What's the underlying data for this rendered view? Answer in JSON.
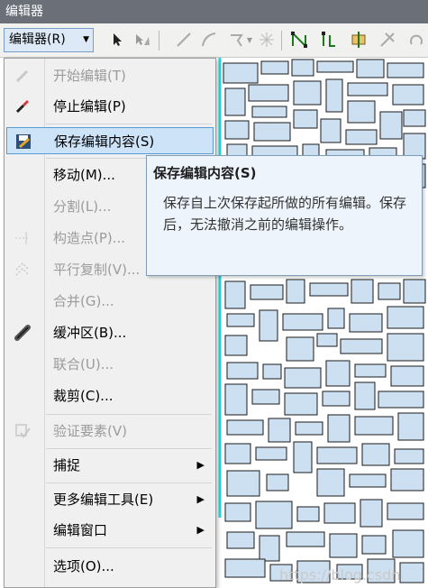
{
  "window": {
    "title": "编辑器"
  },
  "toolbar": {
    "editor_menu_label": "编辑器(R)"
  },
  "menu": {
    "items": [
      {
        "label": "开始编辑(T)",
        "disabled": true
      },
      {
        "label": "停止编辑(P)",
        "disabled": false
      },
      {
        "label": "保存编辑内容(S)",
        "disabled": false,
        "highlighted": true
      },
      {
        "label": "移动(M)...",
        "disabled": false
      },
      {
        "label": "分割(L)...",
        "disabled": true
      },
      {
        "label": "构造点(P)...",
        "disabled": true
      },
      {
        "label": "平行复制(V)...",
        "disabled": true
      },
      {
        "label": "合并(G)...",
        "disabled": true
      },
      {
        "label": "缓冲区(B)...",
        "disabled": false
      },
      {
        "label": "联合(U)...",
        "disabled": true
      },
      {
        "label": "裁剪(C)...",
        "disabled": false
      },
      {
        "label": "验证要素(V)",
        "disabled": true
      },
      {
        "label": "捕捉",
        "submenu": true
      },
      {
        "label": "更多编辑工具(E)",
        "submenu": true
      },
      {
        "label": "编辑窗口",
        "submenu": true
      },
      {
        "label": "选项(O)...",
        "disabled": false
      }
    ]
  },
  "tooltip": {
    "title": "保存编辑内容(S)",
    "body": "保存自上次保存起所做的所有编辑。保存后，无法撤消之前的编辑操作。"
  },
  "watermark": "https://blog.csdn",
  "colors": {
    "titlebar": "#6b6f78",
    "parcel_fill": "#cde0f1",
    "parcel_stroke": "#1a1a1a",
    "highlight": "#cde3f8",
    "tooltip_bg": "#eef4fb"
  }
}
